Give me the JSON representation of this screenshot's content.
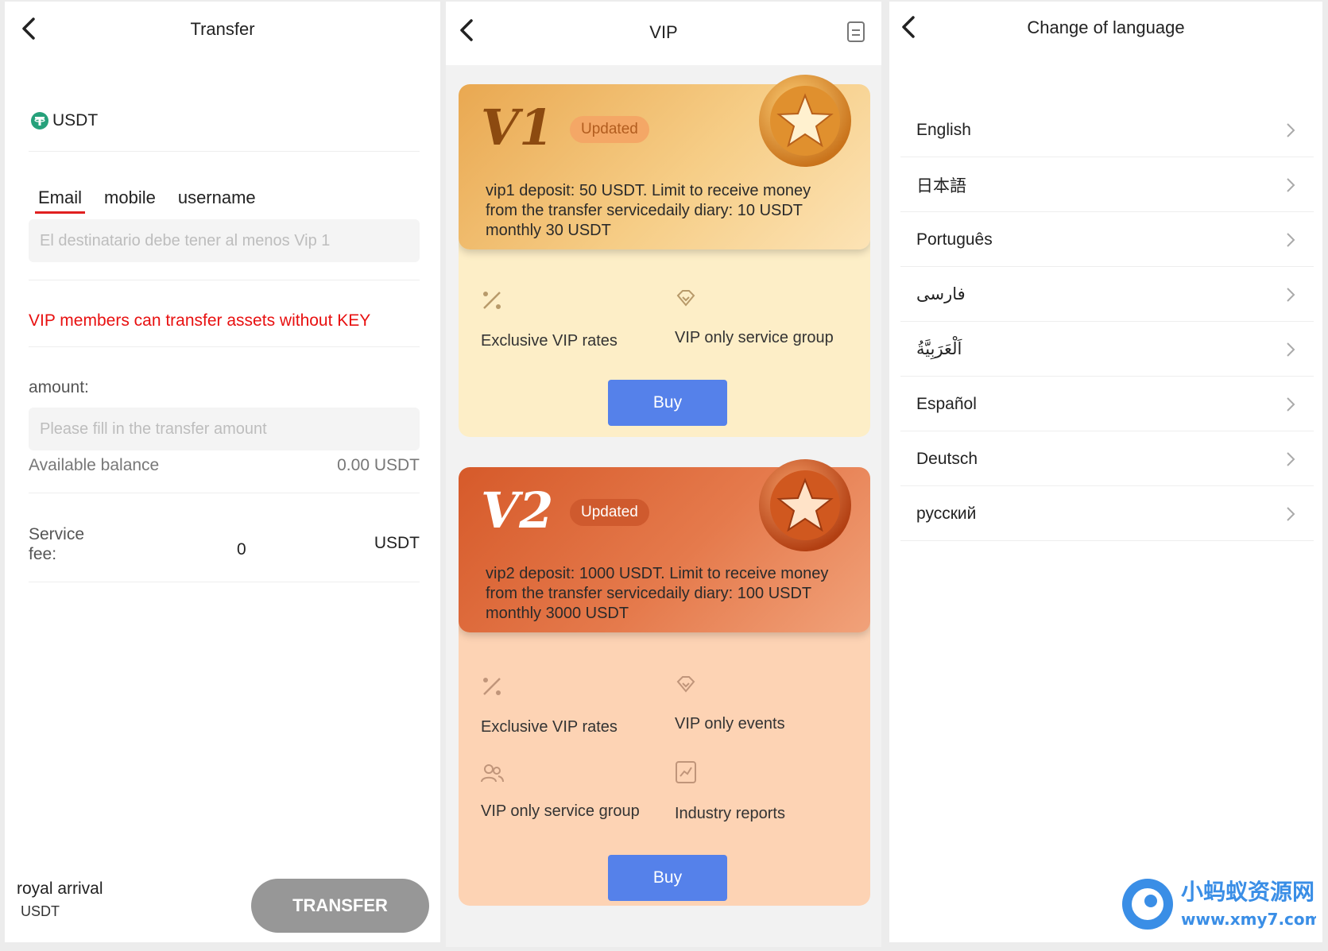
{
  "transfer": {
    "title": "Transfer",
    "coin": "USDT",
    "tabs": [
      "Email",
      "mobile",
      "username"
    ],
    "recipient_placeholder": "El destinatario debe tener al menos Vip 1",
    "vip_notice": "VIP members can transfer assets without KEY",
    "amount_label": "amount:",
    "amount_placeholder": "Please fill in the transfer amount",
    "balance_label": "Available balance",
    "balance_value": "0.00 USDT",
    "fee_label": "Service fee:",
    "fee_value": "0",
    "fee_unit": "USDT",
    "arrival_label": "royal arrival",
    "arrival_unit": "USDT",
    "button": "TRANSFER"
  },
  "vip": {
    "title": "VIP",
    "cards": [
      {
        "level": "V1",
        "status": "Updated",
        "description": "vip1 deposit:  50 USDT. Limit to receive money from the transfer servicedaily diary:  10 USDT monthly 30 USDT",
        "features": [
          "Exclusive VIP rates",
          "VIP only service group"
        ],
        "button": "Buy"
      },
      {
        "level": "V2",
        "status": "Updated",
        "description": "vip2 deposit:  1000 USDT. Limit to receive money from the transfer servicedaily diary:  100 USDT monthly 3000 USDT",
        "features": [
          "Exclusive VIP rates",
          "VIP only events",
          "VIP only service group",
          "Industry reports"
        ],
        "button": "Buy"
      }
    ]
  },
  "language": {
    "title": "Change of language",
    "items": [
      "English",
      "日本語",
      "Português",
      "فارسی",
      "اَلْعَرَبِيَّةُ",
      "Español",
      "Deutsch",
      "русский"
    ]
  },
  "watermark": {
    "cn": "小蚂蚁资源网",
    "url": "www.xmy7.com"
  },
  "colors": {
    "accent_red": "#e81010",
    "buy_blue": "#5581ea",
    "disabled_gray": "#979797"
  }
}
